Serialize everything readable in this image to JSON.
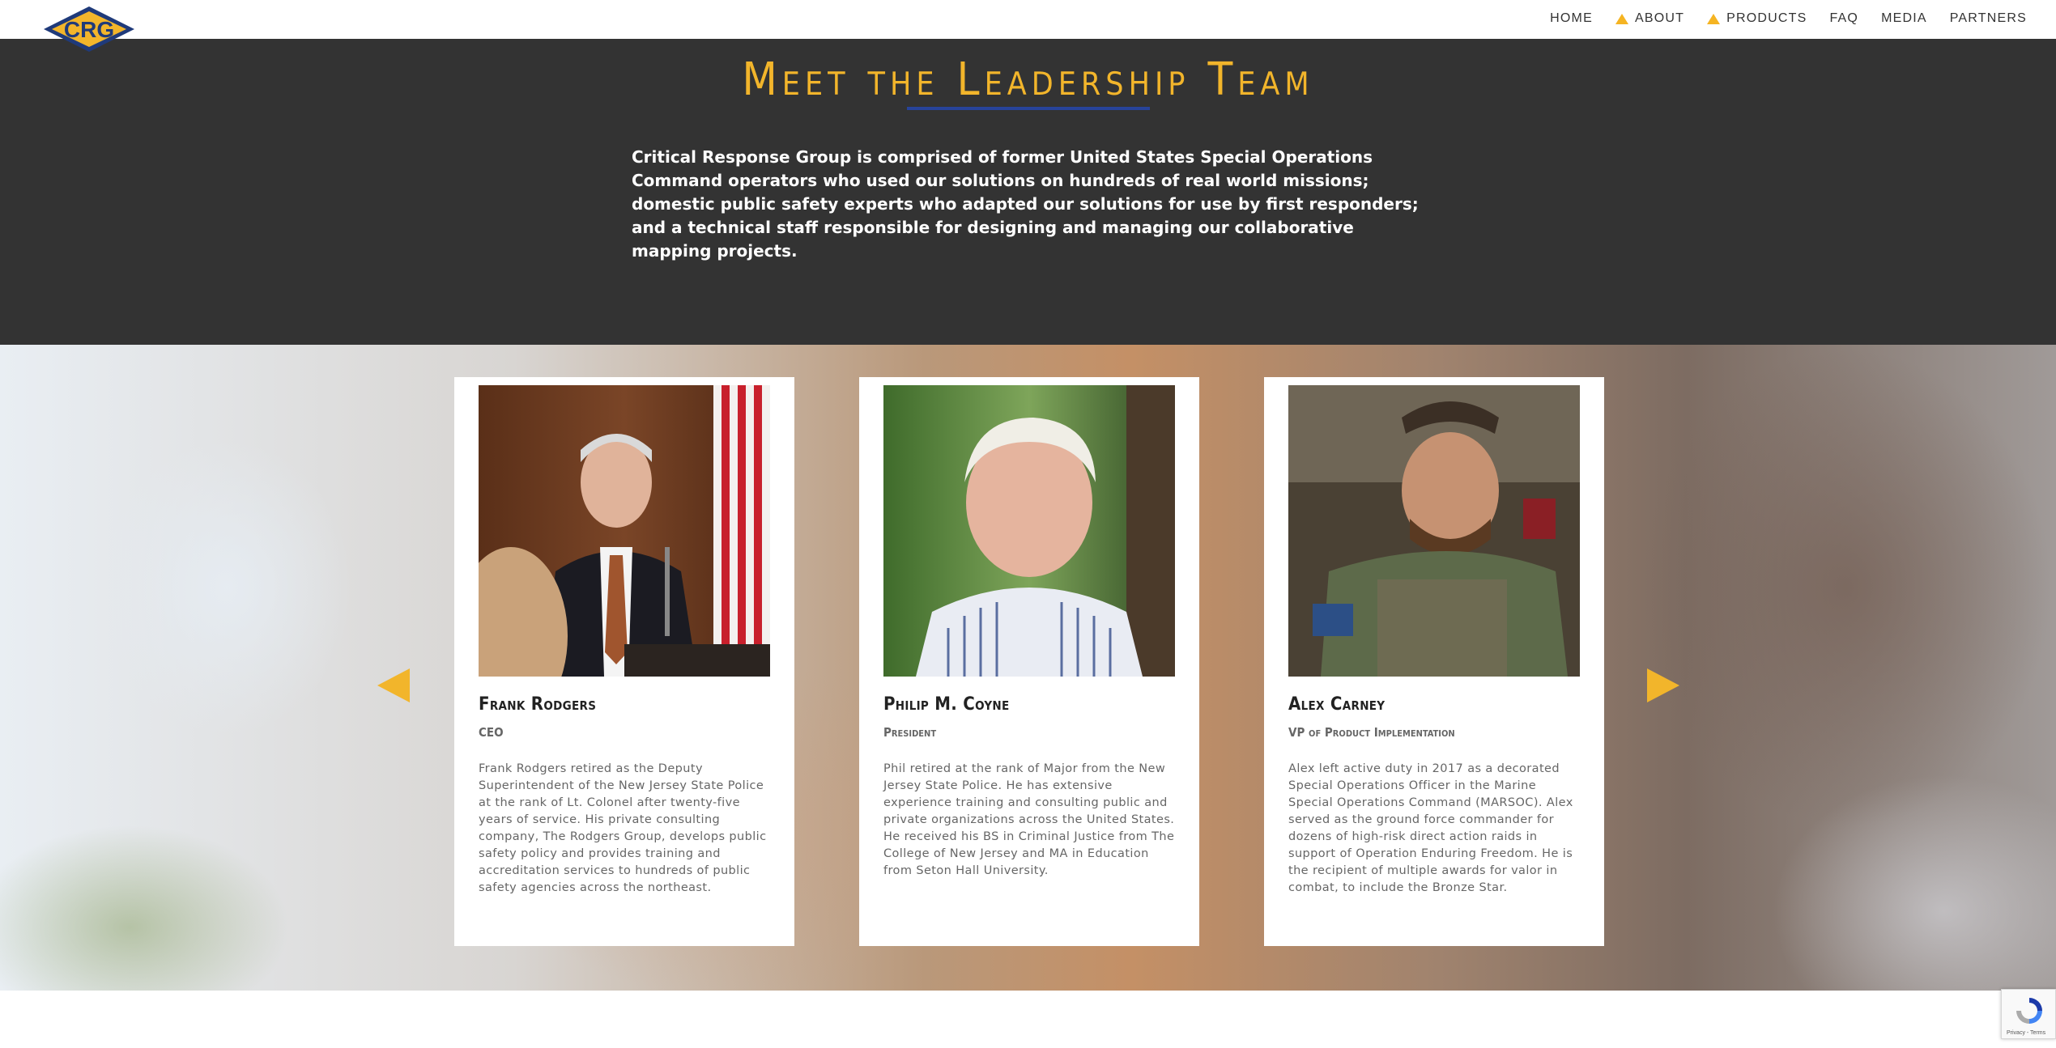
{
  "header": {
    "logo_text": "CRG",
    "nav": [
      {
        "label": "HOME",
        "icon": ""
      },
      {
        "label": "ABOUT",
        "icon": "triangle-icon"
      },
      {
        "label": "PRODUCTS",
        "icon": "triangle-icon"
      },
      {
        "label": "FAQ",
        "icon": ""
      },
      {
        "label": "MEDIA",
        "icon": ""
      },
      {
        "label": "PARTNERS",
        "icon": ""
      }
    ]
  },
  "intro": {
    "title": "Meet the Leadership Team",
    "text": "Critical Response Group is comprised of former United States Special Operations Command operators who used our solutions on hundreds of real world missions; domestic public safety experts who adapted our solutions for use by first responders; and a technical staff responsible for designing and managing our collaborative mapping projects."
  },
  "team": [
    {
      "name": "Frank Rodgers",
      "role": "CEO",
      "bio": "Frank Rodgers retired as the Deputy Superintendent of the New Jersey State Police at the rank of Lt. Colonel after twenty-five years of service. His private consulting company, The Rodgers Group, develops public safety policy and provides training and accreditation services to hundreds of public safety agencies across the northeast."
    },
    {
      "name": "Philip M. Coyne",
      "role": "President",
      "bio": "Phil retired at the rank of Major from the New Jersey State Police.  He has extensive experience training and consulting public and private organizations across the United States.  He received his BS in Criminal Justice from The College of New Jersey and MA in Education from Seton Hall University."
    },
    {
      "name": "Alex Carney",
      "role": "VP of Product Implementation",
      "bio": "Alex left active duty in 2017 as a decorated Special Operations Officer in the Marine Special Operations Command (MARSOC). Alex served as the ground force commander for dozens of high-risk direct action raids in support of Operation Enduring Freedom. He is the recipient of multiple awards for valor in combat, to include the Bronze Star."
    }
  ],
  "carousel": {
    "prev_icon": "arrow-left-icon",
    "next_icon": "arrow-right-icon"
  },
  "recaptcha": {
    "footer_text": "Privacy - Terms"
  },
  "colors": {
    "accent": "#f2b52b",
    "underline": "#27439a",
    "dark_band": "#333333"
  }
}
